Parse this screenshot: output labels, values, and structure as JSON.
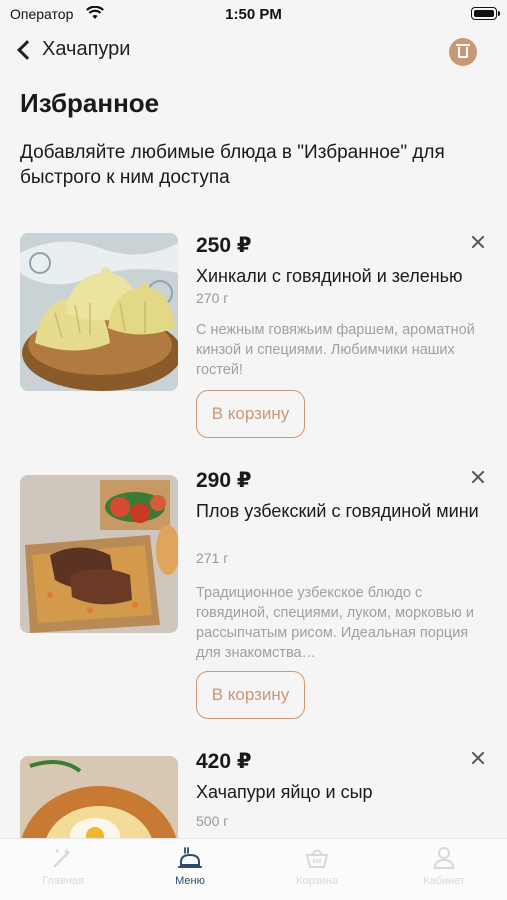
{
  "status_bar": {
    "carrier": "Оператор",
    "time": "1:50 PM"
  },
  "nav": {
    "back_label": "Хачапури"
  },
  "page": {
    "title": "Избранное",
    "subtitle": "Добавляйте любимые блюда в \"Избранное\" для быстрого к ним доступа"
  },
  "items": [
    {
      "price": "250 ₽",
      "name": "Хинкали с говядиной и зеленью",
      "weight": "270 г",
      "description": "С нежным говяжьим фаршем, ароматной кинзой и специями. Любимчики наших гостей!",
      "button": "В корзину",
      "image_icon": "khinkali-photo"
    },
    {
      "price": "290 ₽",
      "name": "Плов узбекский с говядиной мини",
      "weight": "271 г",
      "description": "Традиционное узбекское блюдо с говядиной, специями, луком, морковью и рассыпчатым рисом. Идеальная порция для знакомства…",
      "button": "В корзину",
      "image_icon": "plov-photo"
    },
    {
      "price": "420 ₽",
      "name": "Хачапури яйцо и сыр",
      "weight": "500 г",
      "image_icon": "khachapuri-photo"
    }
  ],
  "tab_bar": {
    "tabs": [
      {
        "label": "Главная",
        "icon": "home-sparkle-icon",
        "active": false
      },
      {
        "label": "Меню",
        "icon": "menu-dish-icon",
        "active": true
      },
      {
        "label": "Корзина",
        "icon": "basket-icon",
        "active": false
      },
      {
        "label": "Кабинет",
        "icon": "profile-icon",
        "active": false
      }
    ]
  },
  "colors": {
    "accent": "#c99877",
    "active_tab": "#2f4b6b",
    "inactive_tab": "#d9d9d9",
    "background": "#f5f5f5"
  }
}
